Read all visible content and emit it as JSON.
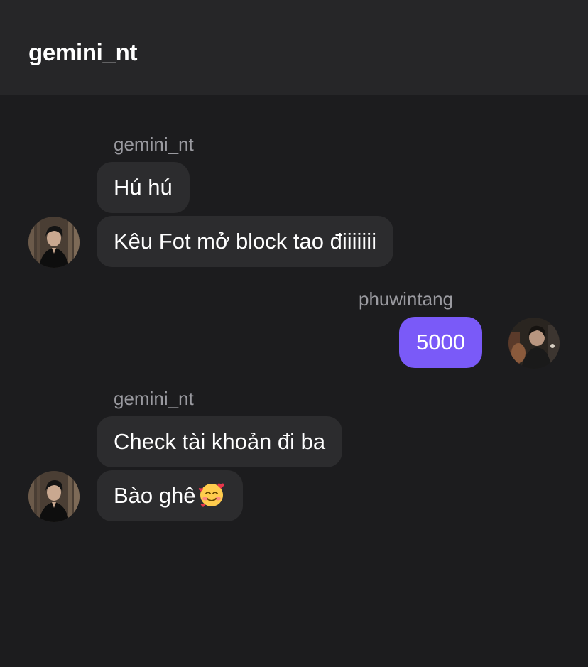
{
  "header": {
    "title": "gemini_nt"
  },
  "messages": [
    {
      "sender": "gemini_nt",
      "direction": "incoming",
      "texts": [
        "Hú hú",
        "Kêu Fot mở block tao điiiiiii"
      ]
    },
    {
      "sender": "phuwintang",
      "direction": "outgoing",
      "texts": [
        "5000"
      ]
    },
    {
      "sender": "gemini_nt",
      "direction": "incoming",
      "texts": [
        "Check tài khoản đi ba",
        "Bào ghê"
      ],
      "emoji": "smiling-face-with-hearts"
    }
  ],
  "colors": {
    "background": "#1c1c1e",
    "header_background": "#262628",
    "incoming_bubble": "#2c2c2e",
    "outgoing_bubble": "#7a5af8",
    "sender_name": "#9a9aa0"
  }
}
